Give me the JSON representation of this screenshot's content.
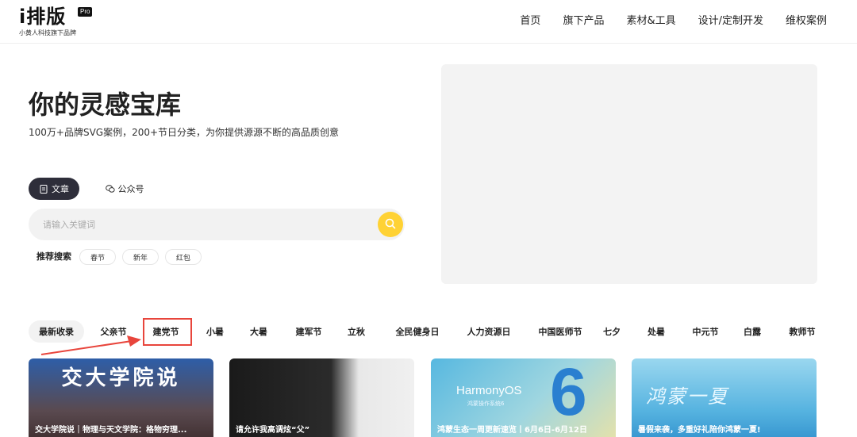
{
  "header": {
    "logo_text": "i排版",
    "logo_badge": "Pro",
    "logo_sub": "小黄人科技旗下品牌",
    "nav": [
      "首页",
      "旗下产品",
      "素材&工具",
      "设计/定制开发",
      "维权案例"
    ]
  },
  "hero": {
    "title": "你的灵感宝库",
    "subtitle": "100万+品牌SVG案例，200+节日分类，为你提供源源不断的高品质创意"
  },
  "search": {
    "tabs": [
      {
        "label": "文章",
        "icon": "document-icon",
        "active": true
      },
      {
        "label": "公众号",
        "icon": "wechat-icon",
        "active": false
      }
    ],
    "placeholder": "请输入关键词",
    "recommend_label": "推荐搜索",
    "recommend_tags": [
      "春节",
      "新年",
      "红包"
    ]
  },
  "categories": [
    "最新收录",
    "父亲节",
    "建党节",
    "小暑",
    "大暑",
    "建军节",
    "立秋",
    "全民健身日",
    "人力资源日",
    "中国医师节",
    "七夕",
    "处暑",
    "中元节",
    "白露",
    "教师节"
  ],
  "cards": [
    {
      "caption": "交大学院说｜物理与天文学院：格物穷理...",
      "art_text": "交大学院说"
    },
    {
      "caption": "请允许我高调炫“父”",
      "art_text": ""
    },
    {
      "caption": "鸿蒙生态一周更新速览丨6月6日-6月12日",
      "art_text": "HarmonyOS",
      "art_sub": "鸿蒙操作系统6",
      "art_num": "6"
    },
    {
      "caption": "暑假来袭，多重好礼陪你鸿蒙一夏!",
      "art_text": "鸿蒙一夏"
    }
  ],
  "colors": {
    "accent_yellow": "#ffd234",
    "tab_active_bg": "#2e2e3a",
    "highlight_red": "#e8453c"
  }
}
